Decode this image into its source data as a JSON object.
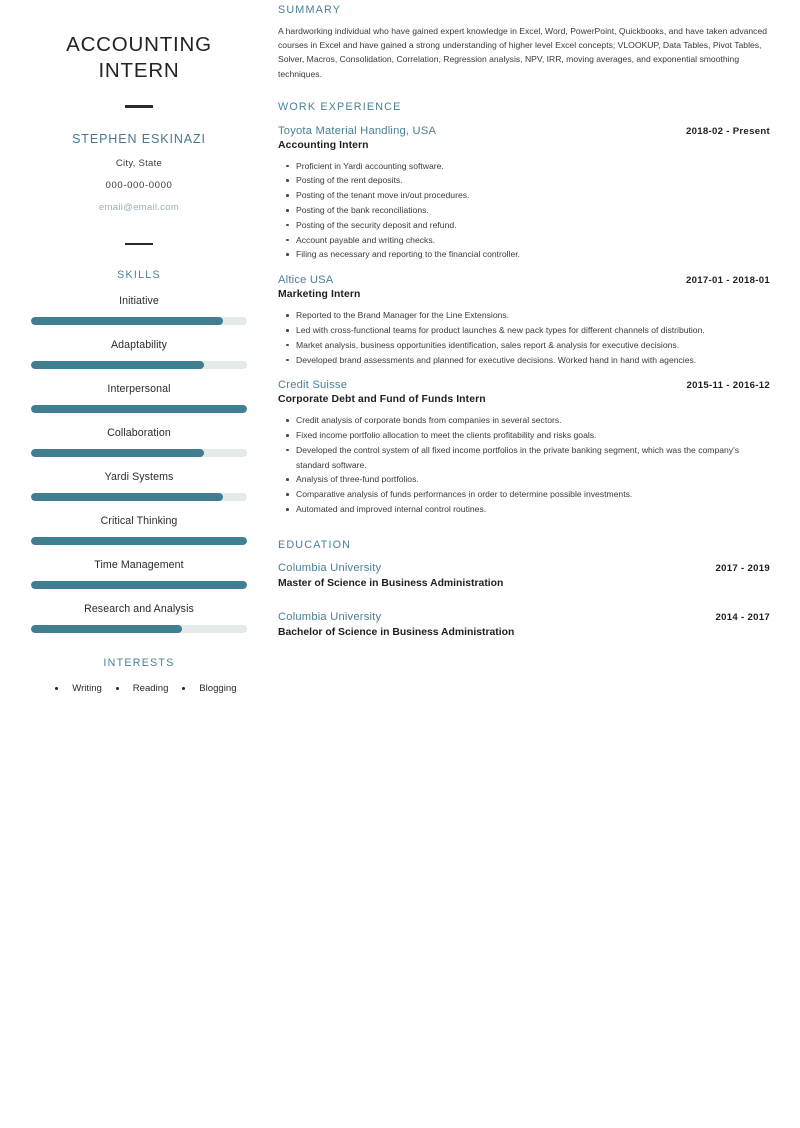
{
  "colors": {
    "accent": "#4a8098",
    "bar_fill": "#407f91",
    "bar_track": "#e4e9e9",
    "email": "#9bb0bb",
    "body_text": "#3a3a3a"
  },
  "left": {
    "title": "ACCOUNTING INTERN",
    "name": "STEPHEN ESKINAZI",
    "location": "City, State",
    "phone": "000-000-0000",
    "email": "email@email.com",
    "skills_heading": "SKILLS",
    "skills": [
      {
        "name": "Initiative",
        "level": 89
      },
      {
        "name": "Adaptability",
        "level": 80
      },
      {
        "name": "Interpersonal",
        "level": 100
      },
      {
        "name": "Collaboration",
        "level": 80
      },
      {
        "name": "Yardi Systems",
        "level": 89
      },
      {
        "name": "Critical Thinking",
        "level": 100
      },
      {
        "name": "Time Management",
        "level": 100
      },
      {
        "name": "Research and Analysis",
        "level": 70
      }
    ],
    "interests_heading": "INTERESTS",
    "interests": [
      "Writing",
      "Reading",
      "Blogging"
    ]
  },
  "right": {
    "summary_heading": "SUMMARY",
    "summary_text": "A hardworking individual who have gained expert knowledge in Excel, Word, PowerPoint, Quickbooks, and have taken advanced courses in Excel and have gained a strong understanding of higher level Excel concepts; VLOOKUP, Data Tables, Pivot Tables, Solver, Macros, Consolidation, Correlation, Regression analysis, NPV, IRR, moving averages, and exponential smoothing techniques.",
    "work_heading": "WORK EXPERIENCE",
    "jobs": [
      {
        "org": "Toyota Material Handling, USA",
        "dates": "2018-02 - Present",
        "role": "Accounting Intern",
        "bullets": [
          "Proficient in Yardi accounting software.",
          "Posting of the rent deposits.",
          "Posting of the tenant move in/out procedures.",
          "Posting of the bank reconciliations.",
          "Posting of the security deposit and refund.",
          "Account payable and writing checks.",
          "Filing as necessary and reporting to the financial controller."
        ]
      },
      {
        "org": "Altice USA",
        "dates": "2017-01 - 2018-01",
        "role": "Marketing Intern",
        "bullets": [
          "Reported to the Brand Manager for the Line Extensions.",
          "Led with cross-functional teams for product launches & new pack types for different channels of distribution.",
          "Market analysis, business opportunities identification, sales report & analysis for executive decisions.",
          "Developed brand assessments and planned for executive decisions. Worked hand in hand with agencies."
        ]
      },
      {
        "org": "Credit Suisse",
        "dates": "2015-11 - 2016-12",
        "role": "Corporate Debt and Fund of Funds Intern",
        "bullets": [
          "Credit analysis of corporate bonds from companies in several sectors.",
          "Fixed income portfolio allocation to meet the clients profitability and risks goals.",
          "Developed the control system of all fixed income portfolios in the private banking segment, which was the company's standard software.",
          "Analysis of three-fund portfolios.",
          "Comparative analysis of funds performances in order to determine possible investments.",
          "Automated and improved internal control routines."
        ]
      }
    ],
    "education_heading": "EDUCATION",
    "education": [
      {
        "school": "Columbia University",
        "dates": "2017 - 2019",
        "degree": "Master of Science in Business Administration"
      },
      {
        "school": "Columbia University",
        "dates": "2014 - 2017",
        "degree": "Bachelor of Science in Business Administration"
      }
    ]
  }
}
